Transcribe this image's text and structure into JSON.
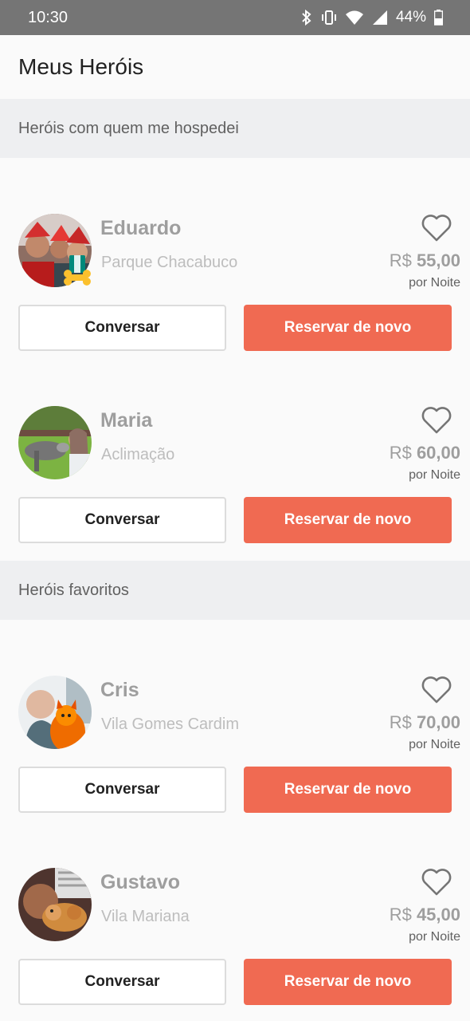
{
  "status_bar": {
    "time": "10:30",
    "battery": "44%",
    "icons": [
      "bluetooth-icon",
      "vibrate-icon",
      "wifi-icon",
      "signal-icon",
      "battery-icon"
    ]
  },
  "app_bar": {
    "title": "Meus Heróis"
  },
  "sections": [
    {
      "title": "Heróis com quem me hospedei",
      "heroes": [
        {
          "name": "Eduardo",
          "place": "Parque Chacabuco",
          "currency": "R$",
          "price": "55,00",
          "per": "por Noite",
          "chat_label": "Conversar",
          "book_label": "Reservar de novo"
        },
        {
          "name": "Maria",
          "place": "Aclimação",
          "currency": "R$",
          "price": "60,00",
          "per": "por Noite",
          "chat_label": "Conversar",
          "book_label": "Reservar de novo"
        }
      ]
    },
    {
      "title": "Heróis favoritos",
      "heroes": [
        {
          "name": "Cris",
          "place": "Vila Gomes Cardim",
          "currency": "R$",
          "price": "70,00",
          "per": "por Noite",
          "chat_label": "Conversar",
          "book_label": "Reservar de novo"
        },
        {
          "name": "Gustavo",
          "place": "Vila Mariana",
          "currency": "R$",
          "price": "45,00",
          "per": "por Noite",
          "chat_label": "Conversar",
          "book_label": "Reservar de novo"
        }
      ]
    }
  ],
  "colors": {
    "accent": "#f06a52",
    "status_bar": "#757575",
    "section_bg": "#eeeff1"
  }
}
